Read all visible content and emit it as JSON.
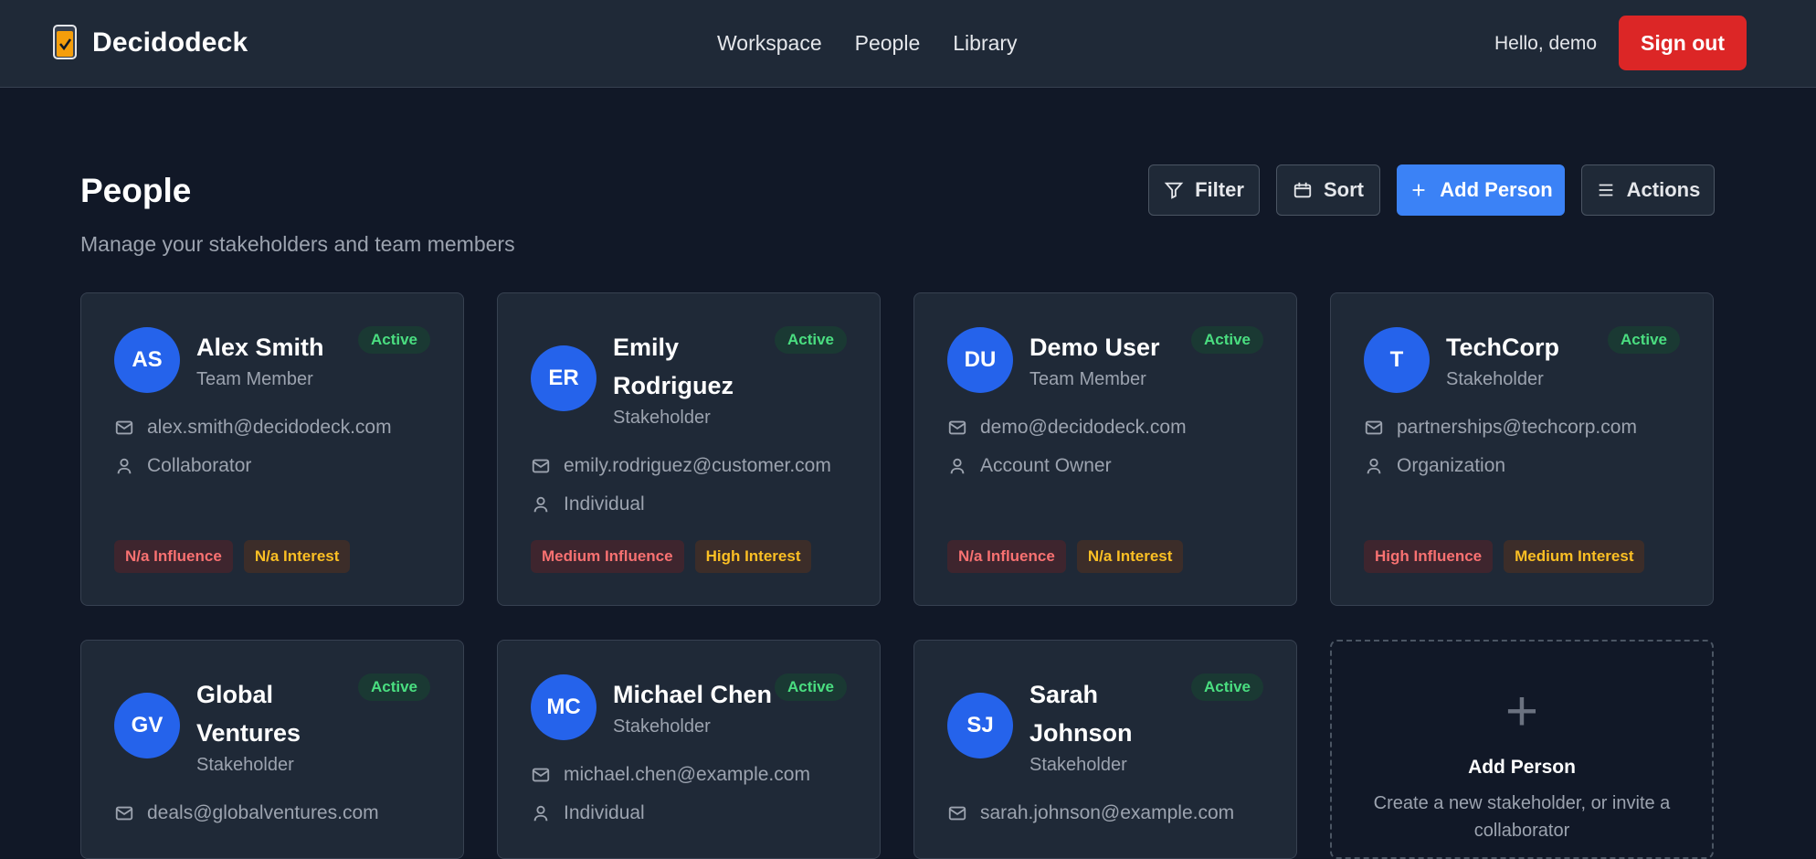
{
  "header": {
    "brand": "Decidodeck",
    "nav": [
      "Workspace",
      "People",
      "Library"
    ],
    "greeting": "Hello, demo",
    "signout": "Sign out"
  },
  "page": {
    "title": "People",
    "subtitle": "Manage your stakeholders and team members"
  },
  "toolbar": {
    "filter": "Filter",
    "sort": "Sort",
    "add_person": "Add Person",
    "actions": "Actions"
  },
  "people": [
    {
      "initials": "AS",
      "name": "Alex Smith",
      "role": "Team Member",
      "status": "Active",
      "email": "alex.smith@decidodeck.com",
      "type": "Collaborator",
      "influence": "N/a Influence",
      "interest": "N/a Interest"
    },
    {
      "initials": "ER",
      "name": "Emily Rodriguez",
      "role": "Stakeholder",
      "status": "Active",
      "email": "emily.rodriguez@customer.com",
      "type": "Individual",
      "influence": "Medium Influence",
      "interest": "High Interest"
    },
    {
      "initials": "DU",
      "name": "Demo User",
      "role": "Team Member",
      "status": "Active",
      "email": "demo@decidodeck.com",
      "type": "Account Owner",
      "influence": "N/a Influence",
      "interest": "N/a Interest"
    },
    {
      "initials": "T",
      "name": "TechCorp",
      "role": "Stakeholder",
      "status": "Active",
      "email": "partnerships@techcorp.com",
      "type": "Organization",
      "influence": "High Influence",
      "interest": "Medium Interest"
    },
    {
      "initials": "GV",
      "name": "Global Ventures",
      "role": "Stakeholder",
      "status": "Active",
      "email": "deals@globalventures.com"
    },
    {
      "initials": "MC",
      "name": "Michael Chen",
      "role": "Stakeholder",
      "status": "Active",
      "email": "michael.chen@example.com",
      "type": "Individual"
    },
    {
      "initials": "SJ",
      "name": "Sarah Johnson",
      "role": "Stakeholder",
      "status": "Active",
      "email": "sarah.johnson@example.com"
    }
  ],
  "add_card": {
    "plus": "+",
    "title": "Add Person",
    "description": "Create a new stakeholder, or invite a collaborator"
  }
}
